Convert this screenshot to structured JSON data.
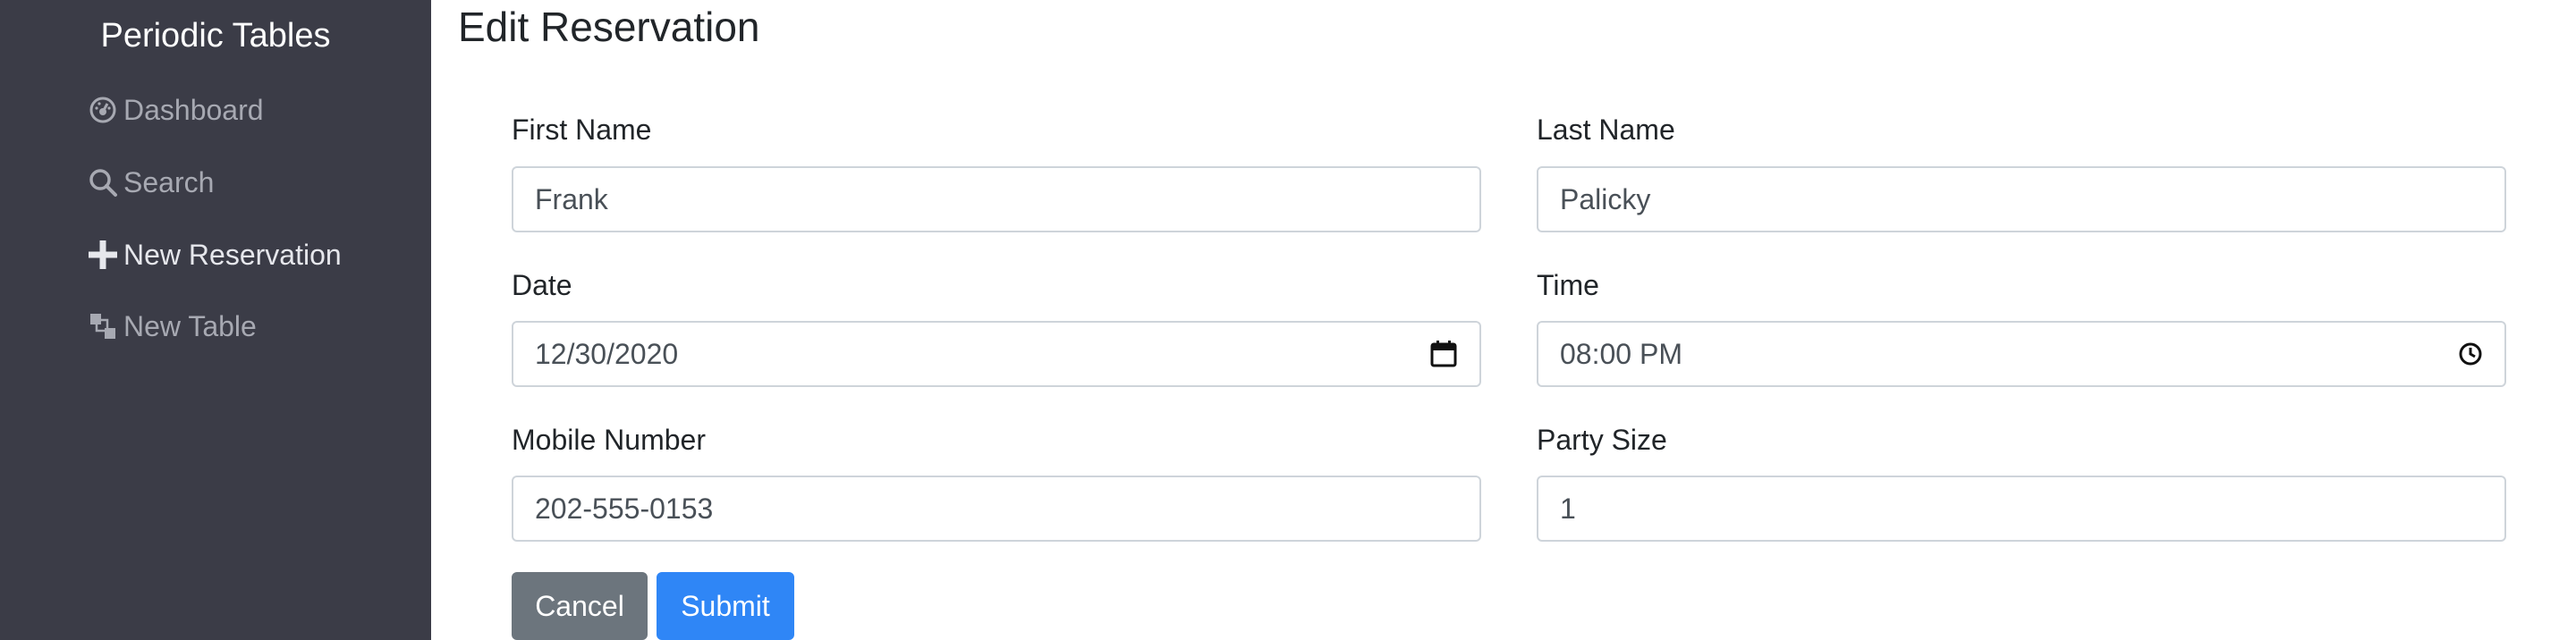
{
  "sidebar": {
    "brand": "Periodic Tables",
    "items": [
      {
        "label": "Dashboard",
        "icon": "dashboard-icon"
      },
      {
        "label": "Search",
        "icon": "search-icon"
      },
      {
        "label": "New Reservation",
        "icon": "plus-icon"
      },
      {
        "label": "New Table",
        "icon": "layers-icon"
      }
    ]
  },
  "main": {
    "title": "Edit Reservation",
    "form": {
      "first_name": {
        "label": "First Name",
        "value": "Frank"
      },
      "last_name": {
        "label": "Last Name",
        "value": "Palicky"
      },
      "date": {
        "label": "Date",
        "value": "12/30/2020",
        "icon": "calendar-icon"
      },
      "time": {
        "label": "Time",
        "value": "08:00 PM",
        "icon": "clock-icon"
      },
      "mobile_number": {
        "label": "Mobile Number",
        "value": "202-555-0153"
      },
      "party_size": {
        "label": "Party Size",
        "value": "1"
      }
    },
    "buttons": {
      "cancel": "Cancel",
      "submit": "Submit"
    }
  },
  "colors": {
    "sidebar_bg": "#3b3c47",
    "submit": "#2f86f6",
    "cancel": "#6c757d",
    "input_border": "#ced4da"
  }
}
